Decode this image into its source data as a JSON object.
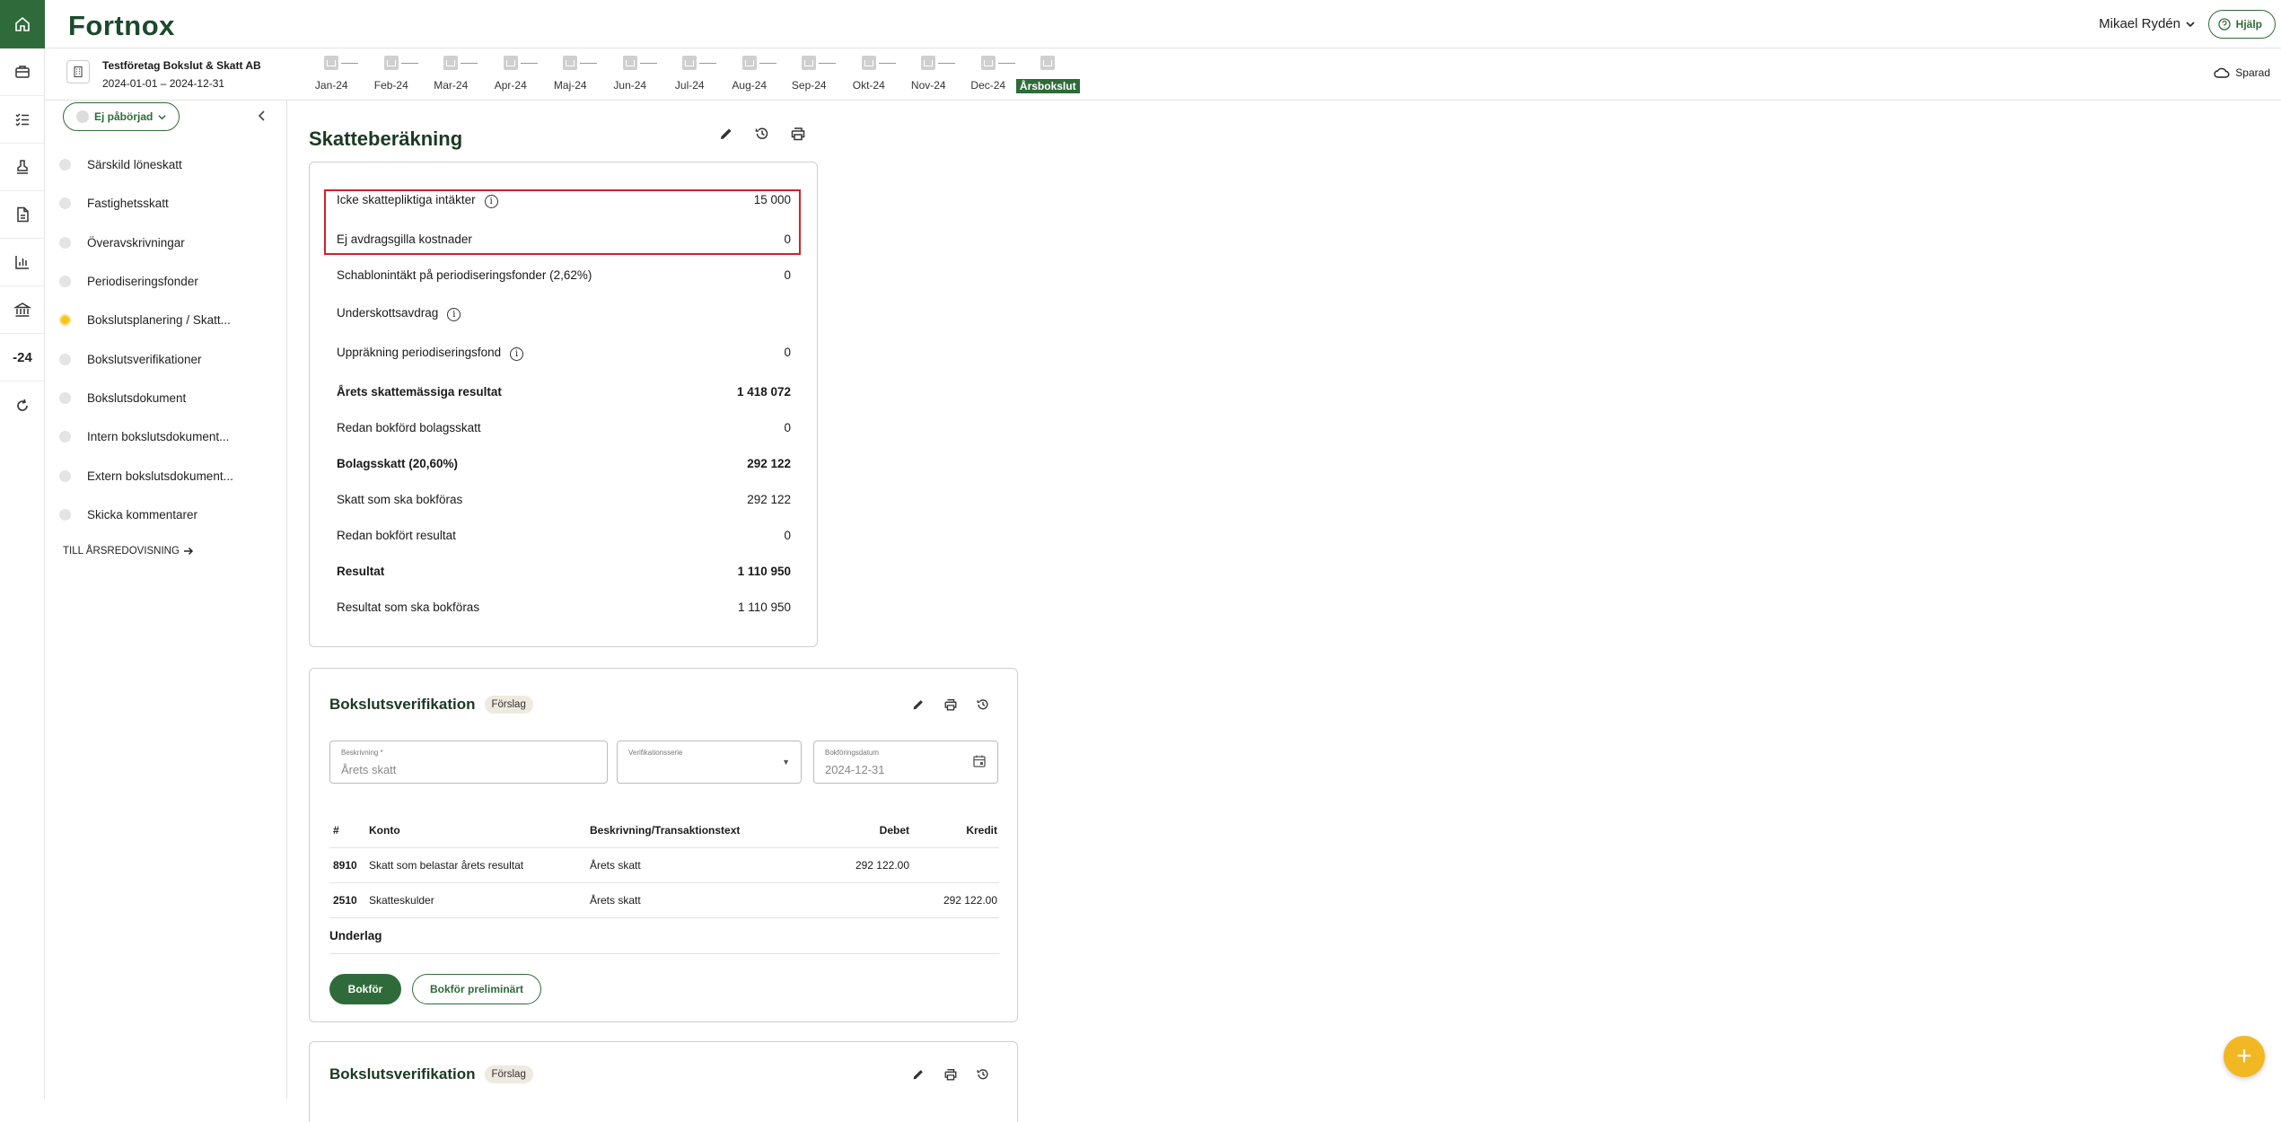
{
  "rail": {
    "items": [
      {
        "icon": "home-icon"
      },
      {
        "icon": "briefcase-icon"
      },
      {
        "icon": "checklist-icon"
      },
      {
        "icon": "stamp-icon"
      },
      {
        "icon": "document-icon"
      },
      {
        "icon": "bar-chart-icon"
      },
      {
        "icon": "bank-icon"
      },
      {
        "label": "-24"
      },
      {
        "icon": "refresh-icon"
      }
    ]
  },
  "header": {
    "logo": "Fortnox",
    "user": "Mikael Rydén",
    "help": "Hjälp"
  },
  "company": {
    "name": "Testföretag Bokslut & Skatt AB",
    "period": "2024-01-01 – 2024-12-31"
  },
  "months": [
    "Jan-24",
    "Feb-24",
    "Mar-24",
    "Apr-24",
    "Maj-24",
    "Jun-24",
    "Jul-24",
    "Aug-24",
    "Sep-24",
    "Okt-24",
    "Nov-24",
    "Dec-24",
    "Årsbokslut"
  ],
  "saved": "Sparad",
  "sidebar": {
    "status": "Ej påbörjad",
    "items": [
      {
        "label": "Särskild löneskatt"
      },
      {
        "label": "Fastighetsskatt"
      },
      {
        "label": "Överavskrivningar"
      },
      {
        "label": "Periodiseringsfonder"
      },
      {
        "label": "Bokslutsplanering / Skatt..."
      },
      {
        "label": "Bokslutsverifikationer"
      },
      {
        "label": "Bokslutsdokument"
      },
      {
        "label": "Intern bokslutsdokument..."
      },
      {
        "label": "Extern bokslutsdokument..."
      },
      {
        "label": "Skicka kommentarer"
      }
    ],
    "to_annual": "TILL ÅRSREDOVISNING"
  },
  "tax": {
    "title": "Skatteberäkning",
    "rows": [
      {
        "label": "Icke skattepliktiga intäkter",
        "value": "15 000"
      },
      {
        "label": "Ej avdragsgilla kostnader",
        "value": "0"
      },
      {
        "label": "Schablonintäkt på periodiseringsfonder (2,62%)",
        "value": "0"
      },
      {
        "label": "Underskottsavdrag",
        "value": ""
      },
      {
        "label": "Uppräkning periodiseringsfond",
        "value": "0"
      },
      {
        "label": "Årets skattemässiga resultat",
        "value": "1 418 072"
      },
      {
        "label": "Redan bokförd bolagsskatt",
        "value": "0"
      },
      {
        "label": "Bolagsskatt (20,60%)",
        "value": "292 122"
      },
      {
        "label": "Skatt som ska bokföras",
        "value": "292 122"
      },
      {
        "label": "Redan bokfört resultat",
        "value": "0"
      },
      {
        "label": "Resultat",
        "value": "1 110 950"
      },
      {
        "label": "Resultat som ska bokföras",
        "value": "1 110 950"
      }
    ]
  },
  "voucher1": {
    "title": "Bokslutsverifikation",
    "badge": "Förslag",
    "desc_label": "Beskrivning *",
    "desc_value": "Årets skatt",
    "series_label": "Verifikationsserie",
    "date_label": "Bokföringsdatum",
    "date_value": "2024-12-31",
    "headers": {
      "num": "#",
      "account": "Konto",
      "desc": "Beskrivning/Transaktionstext",
      "debit": "Debet",
      "credit": "Kredit"
    },
    "rows": [
      {
        "num": "8910",
        "account": "Skatt som belastar årets resultat",
        "desc": "Årets skatt",
        "debit": "292 122.00",
        "credit": ""
      },
      {
        "num": "2510",
        "account": "Skatteskulder",
        "desc": "Årets skatt",
        "debit": "",
        "credit": "292 122.00"
      }
    ],
    "underlag": "Underlag",
    "book": "Bokför",
    "book_prelim": "Bokför preliminärt"
  },
  "voucher2": {
    "title": "Bokslutsverifikation",
    "badge": "Förslag"
  },
  "fab": "+"
}
